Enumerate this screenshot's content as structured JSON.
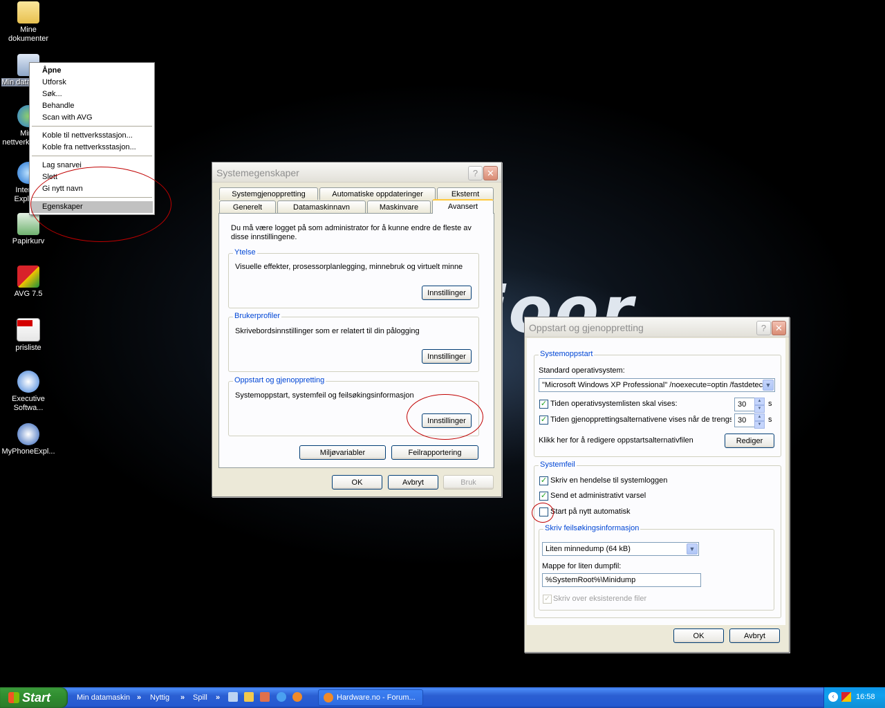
{
  "desktop": {
    "icons": [
      {
        "label": "Mine dokumenter"
      },
      {
        "label": "Min datamaskin"
      },
      {
        "label": "Mine nettverkssteder"
      },
      {
        "label": "Internet Explorer"
      },
      {
        "label": "Papirkurv"
      },
      {
        "label": "AVG 7.5"
      },
      {
        "label": "prisliste"
      },
      {
        "label": "Executive Softwa..."
      },
      {
        "label": "MyPhoneExpl..."
      }
    ],
    "wallpaper_text": "ioor"
  },
  "context_menu": {
    "items": [
      "Åpne",
      "Utforsk",
      "Søk...",
      "Behandle",
      "Scan with AVG",
      "Koble til nettverksstasjon...",
      "Koble fra nettverksstasjon...",
      "Lag snarvei",
      "Slett",
      "Gi nytt navn",
      "Egenskaper"
    ],
    "highlighted": "Egenskaper"
  },
  "system_properties": {
    "title": "Systemegenskaper",
    "help": "?",
    "close": "✕",
    "tabs_row1": [
      "Systemgjenoppretting",
      "Automatiske oppdateringer",
      "Eksternt"
    ],
    "tabs_row2": [
      "Generelt",
      "Datamaskinnavn",
      "Maskinvare",
      "Avansert"
    ],
    "active_tab": "Avansert",
    "intro": "Du må være logget på som administrator for å kunne endre de fleste av disse innstillingene.",
    "groups": [
      {
        "legend": "Ytelse",
        "text": "Visuelle effekter, prosessorplanlegging, minnebruk og virtuelt minne",
        "button": "Innstillinger"
      },
      {
        "legend": "Brukerprofiler",
        "text": "Skrivebordsinnstillinger som er relatert til din pålogging",
        "button": "Innstillinger"
      },
      {
        "legend": "Oppstart og gjenoppretting",
        "text": "Systemoppstart, systemfeil og feilsøkingsinformasjon",
        "button": "Innstillinger"
      }
    ],
    "env_button": "Miljøvariabler",
    "error_button": "Feilrapportering",
    "ok": "OK",
    "cancel": "Avbryt",
    "apply": "Bruk"
  },
  "startup_recovery": {
    "title": "Oppstart og gjenoppretting",
    "help": "?",
    "close": "✕",
    "startup_legend": "Systemoppstart",
    "default_os_label": "Standard operativsystem:",
    "default_os_value": "\"Microsoft Windows XP Professional\" /noexecute=optin /fastdetect",
    "show_list_label": "Tiden operativsystemlisten skal vises:",
    "show_list_value": "30",
    "show_recovery_label": "Tiden gjenopprettingsalternativene vises når de trengs",
    "show_recovery_value": "30",
    "seconds": "s",
    "edit_label": "Klikk her for å redigere oppstartsalternativfilen",
    "edit_button": "Rediger",
    "failure_legend": "Systemfeil",
    "write_event": "Skriv en hendelse til systemloggen",
    "send_alert": "Send et administrativt varsel",
    "auto_restart": "Start på nytt automatisk",
    "debug_legend": "Skriv feilsøkingsinformasjon",
    "dump_type": "Liten minnedump (64 kB)",
    "dump_dir_label": "Mappe for liten dumpfil:",
    "dump_dir_value": "%SystemRoot%\\Minidump",
    "overwrite": "Skriv over eksisterende filer",
    "ok": "OK",
    "cancel": "Avbryt"
  },
  "taskbar": {
    "start": "Start",
    "toolbars": [
      "Min datamaskin",
      "Nyttig",
      "Spill"
    ],
    "window_button": "Hardware.no - Forum...",
    "clock": "16:58"
  }
}
